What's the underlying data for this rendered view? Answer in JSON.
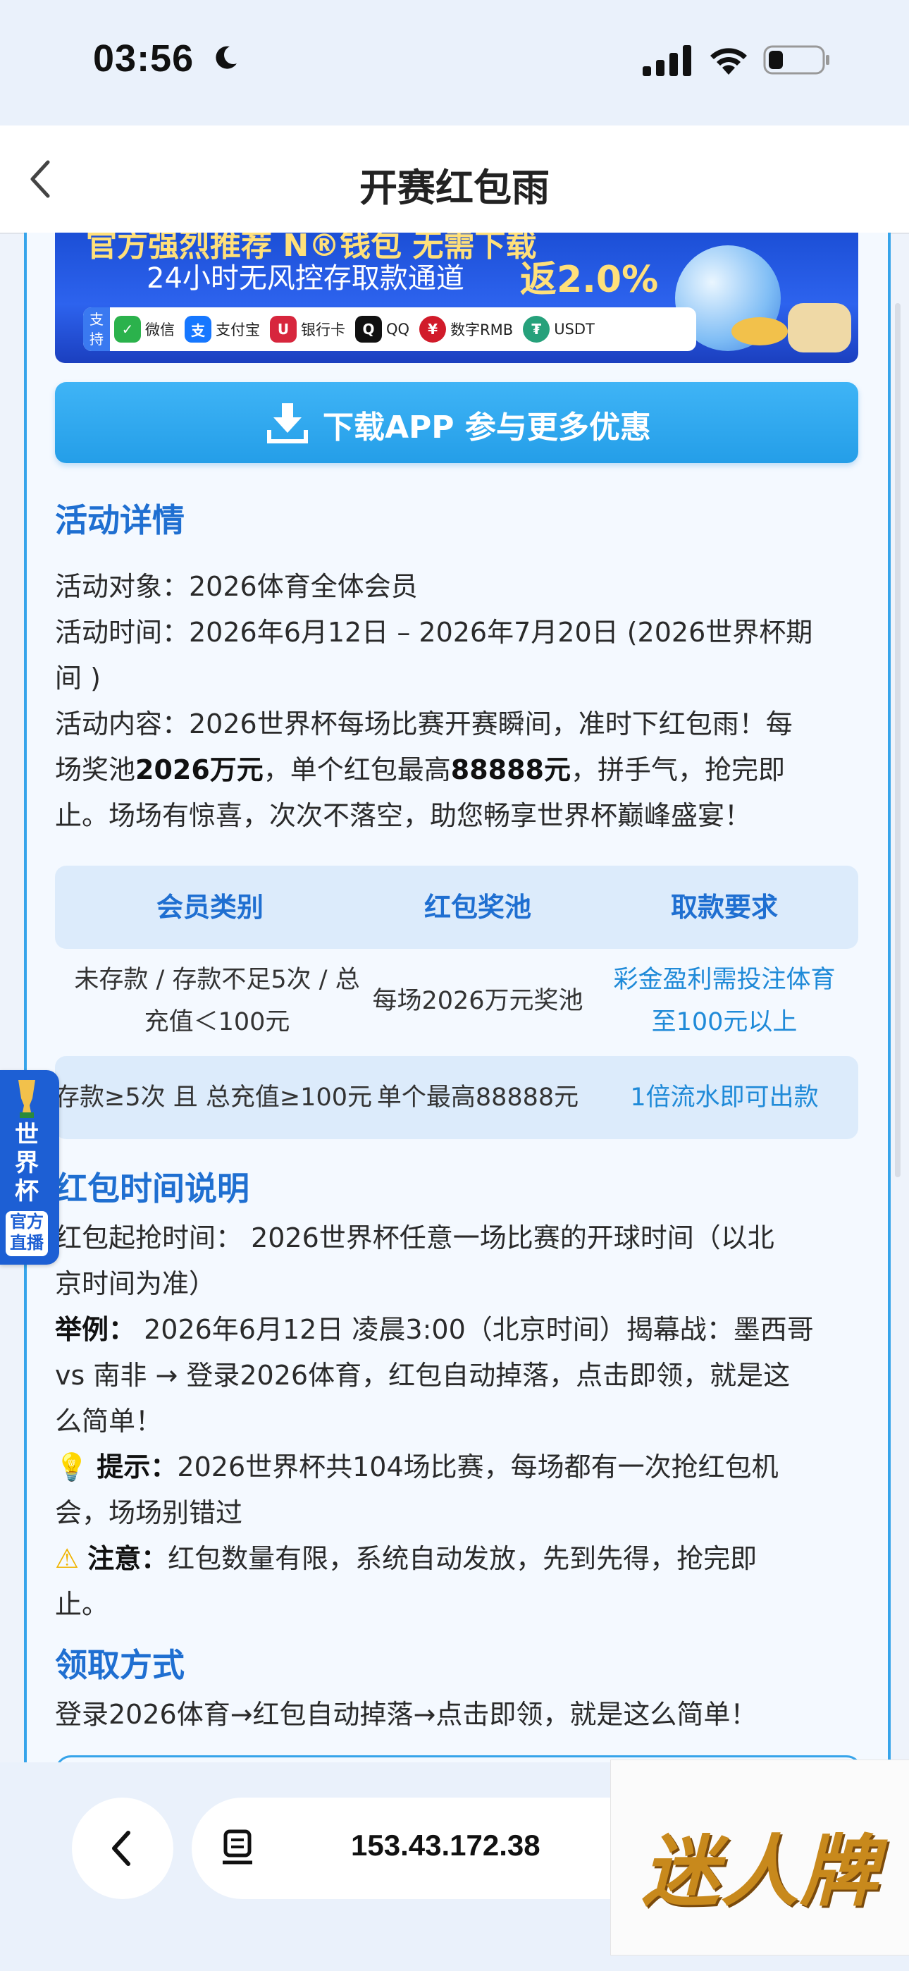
{
  "status_bar": {
    "time": "03:56"
  },
  "nav": {
    "title": "开赛红包雨"
  },
  "banner": {
    "headline": "官方强烈推荐 N®钱包 无需下载",
    "subline": "24小时无风控存取款通道",
    "rebate": "返2.0%",
    "support_label": "支持",
    "payments": [
      "微信",
      "支付宝",
      "银行卡",
      "QQ",
      "数字RMB",
      "USDT"
    ]
  },
  "download_button": {
    "label": "下载APP 参与更多优惠"
  },
  "details": {
    "heading": "活动详情",
    "target": "活动对象：2026体育全体会员",
    "time_line1": "活动时间：2026年6月12日 – 2026年7月20日 (2026世界杯期",
    "time_line2": "间 )",
    "content_line1": "活动内容：2026世界杯每场比赛开赛瞬间，准时下红包雨！每",
    "content_line2_a": "场奖池",
    "content_line2_b": "2026万元",
    "content_line2_c": "，单个红包最高",
    "content_line2_d": "88888元",
    "content_line2_e": "，拼手气，抢完即",
    "content_line3": "止。场场有惊喜，次次不落空，助您畅享世界杯巅峰盛宴！"
  },
  "table": {
    "headers": [
      "会员类别",
      "红包奖池",
      "取款要求"
    ],
    "rows": [
      [
        "未存款 / 存款不足5次 / 总充值＜100元",
        "每场2026万元奖池",
        "彩金盈利需投注体育至100元以上"
      ],
      [
        "存款≥5次 且 总充值≥100元",
        "单个最高88888元",
        "1倍流水即可出款"
      ]
    ],
    "row1_col1_line1": "未存款 / 存款不足5次 / 总",
    "row1_col1_line2": "充值＜100元",
    "row1_col3_line1": "彩金盈利需投注体育",
    "row1_col3_line2": "至100元以上"
  },
  "time_section": {
    "heading": "红包时间说明",
    "start_line1": "红包起抢时间： 2026世界杯任意一场比赛的开球时间（以北",
    "start_line2": "京时间为准）",
    "example_label": "举例：",
    "example_line1": " 2026年6月12日 凌晨3:00（北京时间）揭幕战：墨西哥",
    "example_line2": "vs 南非 → 登录2026体育，红包自动掉落，点击即领，就是这",
    "example_line3": "么简单！",
    "tip_label": "提示：",
    "tip_line1": "2026世界杯共104场比赛，每场都有一次抢红包机",
    "tip_line2": "会，场场别错过",
    "note_label": "注意：",
    "note_line1": "红包数量有限，系统自动发放，先到先得，抢完即",
    "note_line2": "止。"
  },
  "claim": {
    "heading": "领取方式",
    "text": "登录2026体育→红包自动掉落→点击即领，就是这么简单！"
  },
  "floating_tab": {
    "title": "世界杯",
    "subtitle": "官方直播"
  },
  "browser": {
    "url": "153.43.172.38"
  },
  "watermark": {
    "text": "迷人牌"
  },
  "colors": {
    "accent": "#1f6fd1",
    "button": "#249ee8",
    "table_bg": "#dcebfb",
    "watermark": "#c8891c"
  }
}
